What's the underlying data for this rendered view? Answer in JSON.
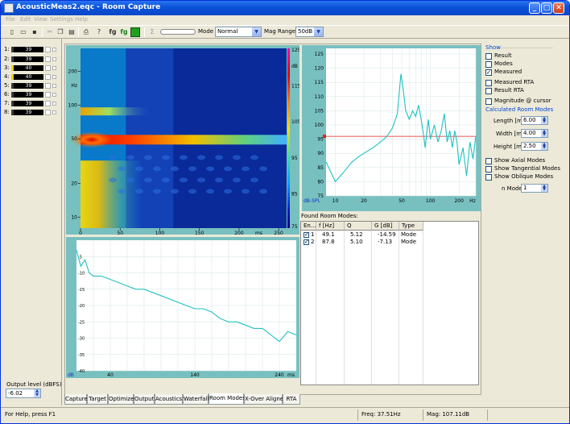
{
  "window": {
    "title": "AcousticMeas2.eqc - Room Capture"
  },
  "menu": [
    "File",
    "Edit",
    "View",
    "Settings",
    "Help"
  ],
  "toolbar": {
    "icons": [
      "new-file-icon",
      "open-folder-icon",
      "save-icon",
      "cut-icon",
      "copy-icon",
      "paste-icon",
      "print-icon",
      "help-icon",
      "fg-icon",
      "fg-icon-2",
      "green-square-icon",
      "sigma-icon"
    ],
    "mode_label": "Mode",
    "mode_value": "Normal",
    "mag_label": "Mag Range",
    "mag_value": "50dB"
  },
  "channels": [
    {
      "num": "1:",
      "value": "39"
    },
    {
      "num": "2:",
      "value": "39"
    },
    {
      "num": "3:",
      "value": "40"
    },
    {
      "num": "4:",
      "value": "40"
    },
    {
      "num": "5:",
      "value": "39"
    },
    {
      "num": "6:",
      "value": "39"
    },
    {
      "num": "7:",
      "value": "39"
    },
    {
      "num": "8:",
      "value": "39"
    }
  ],
  "output": {
    "label": "Output level (dBFS)",
    "value": "-6.02"
  },
  "spectrogram": {
    "y_ticks": [
      "200",
      "100",
      "50",
      "20",
      "10"
    ],
    "y_unit": "Hz",
    "x_ticks": [
      "0",
      "50",
      "100",
      "150",
      "200",
      "250"
    ],
    "x_unit": "ms",
    "colorbar_ticks": [
      "125",
      "115",
      "105",
      "95",
      "85",
      "75"
    ],
    "colorbar_unit": "dB"
  },
  "chart_data": [
    {
      "type": "heatmap",
      "title": "",
      "xlabel": "ms",
      "ylabel": "Hz",
      "xlim": [
        0,
        260
      ],
      "ylim": [
        8,
        320
      ],
      "yscale": "log",
      "color_range": [
        75,
        125
      ],
      "color_label": "dB",
      "ridges": [
        {
          "freq_hz": 49.1,
          "decay_ms": 260
        },
        {
          "freq_hz": 87.8,
          "decay_ms": 90
        }
      ]
    },
    {
      "type": "line",
      "title": "",
      "xlabel": "Hz",
      "ylabel": "dB-SPL",
      "xscale": "log",
      "xlim": [
        8,
        300
      ],
      "ylim": [
        75,
        127
      ],
      "x_ticks": [
        "10",
        "20",
        "50",
        "100",
        "200"
      ],
      "y_ticks": [
        "125",
        "120",
        "115",
        "110",
        "105",
        "100",
        "95",
        "90",
        "85",
        "80",
        "75"
      ],
      "x": [
        8,
        10,
        12,
        15,
        18,
        20,
        25,
        30,
        35,
        40,
        45,
        49,
        52,
        55,
        60,
        65,
        70,
        75,
        80,
        85,
        88,
        95,
        100,
        110,
        120,
        130,
        140,
        150,
        160,
        170,
        180,
        190,
        200,
        220,
        240,
        260,
        280,
        300
      ],
      "series": [
        {
          "values": [
            87,
            80,
            83,
            87,
            89,
            90,
            92,
            94,
            96,
            99,
            104,
            118,
            112,
            105,
            102,
            105,
            103,
            107,
            102,
            96,
            92,
            102,
            95,
            100,
            94,
            98,
            104,
            94,
            98,
            92,
            98,
            94,
            86,
            92,
            82,
            94,
            88,
            96
          ]
        }
      ],
      "cursor_db": 96
    },
    {
      "type": "line",
      "title": "",
      "xlabel": "ms",
      "ylabel": "dB",
      "xlim": [
        0,
        260
      ],
      "ylim": [
        -40,
        0
      ],
      "x_ticks": [
        "40",
        "140",
        "240"
      ],
      "y_ticks": [
        "-5",
        "-10",
        "-15",
        "-20",
        "-25",
        "-30",
        "-35",
        "-40"
      ],
      "x": [
        0,
        5,
        10,
        15,
        20,
        30,
        40,
        50,
        60,
        70,
        80,
        90,
        100,
        110,
        120,
        130,
        140,
        150,
        160,
        170,
        180,
        190,
        200,
        210,
        220,
        230,
        240,
        250,
        260
      ],
      "series": [
        {
          "values": [
            -3,
            -8,
            -6,
            -10,
            -11,
            -11,
            -12,
            -13,
            -14,
            -15,
            -15,
            -16,
            -17,
            -18,
            -19,
            -20,
            -21,
            -21,
            -22,
            -24,
            -25,
            -25,
            -26,
            -27,
            -27,
            -29,
            -31,
            -28,
            -29
          ]
        }
      ]
    }
  ],
  "found_modes": {
    "title": "Found Room Modes:",
    "columns": [
      "En...",
      "f [Hz]",
      "Q",
      "G [dB]",
      "Type"
    ],
    "rows": [
      {
        "en": "1",
        "f": "49.1",
        "q": "5.12",
        "g": "-14.59",
        "type": "Mode"
      },
      {
        "en": "2",
        "f": "87.8",
        "q": "5.10",
        "g": "-7.13",
        "type": "Mode"
      }
    ]
  },
  "show_panel": {
    "title": "Show",
    "checks": [
      {
        "label": "Result",
        "checked": false
      },
      {
        "label": "Modes",
        "checked": false
      },
      {
        "label": "Measured",
        "checked": true
      },
      {
        "label": "Measured RTA",
        "checked": false
      },
      {
        "label": "Result RTA",
        "checked": false
      },
      {
        "label": "Magnitude @ cursor",
        "checked": false
      }
    ],
    "calc_title": "Calculated Room Modes",
    "length_label": "Length [m]",
    "length_value": "6.00",
    "width_label": "Width [m]",
    "width_value": "4.00",
    "height_label": "Height [m]",
    "height_value": "2.50",
    "mode_checks": [
      {
        "label": "Show Axial Modes"
      },
      {
        "label": "Show Tangential Modes"
      },
      {
        "label": "Show Oblique Modes"
      }
    ],
    "nmodes_label": "n Modes",
    "nmodes_value": "1"
  },
  "tabs": [
    "Capture",
    "Target",
    "Optimizer",
    "Output",
    "Acoustics",
    "Waterfall",
    "Room Modes",
    "X-Over Aligner",
    "RTA"
  ],
  "active_tab": "Room Modes",
  "status": {
    "help": "For Help, press F1",
    "freq": "Freq: 37.51Hz",
    "mag": "Mag: 107.11dB"
  },
  "colors": {
    "plot_frame": "#78c0c0",
    "trace": "#20c0c0",
    "cursor_line": "#e02020",
    "title_bar": "#0a52d8",
    "section_blue": "#0046d5"
  }
}
